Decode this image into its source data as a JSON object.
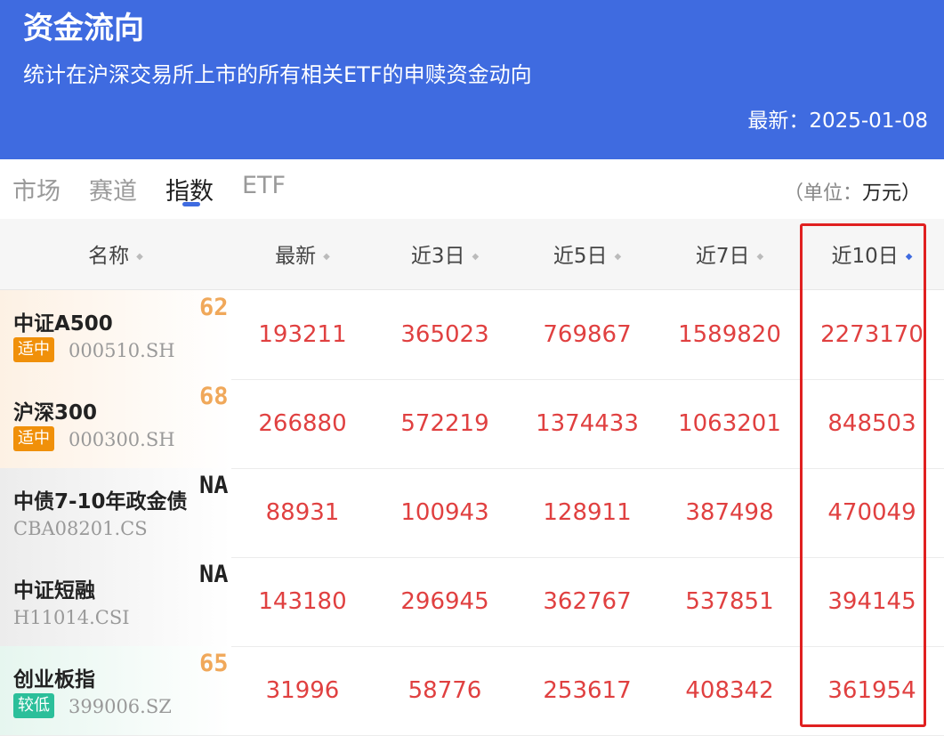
{
  "header": {
    "title": "资金流向",
    "subtitle": "统计在沪深交易所上市的所有相关ETF的申赎资金动向",
    "updated": "最新：2025-01-08"
  },
  "tabs": [
    {
      "label": "市场",
      "active": false
    },
    {
      "label": "赛道",
      "active": false
    },
    {
      "label": "指数",
      "active": true
    },
    {
      "label": "ETF",
      "active": false
    }
  ],
  "unit": {
    "prefix": "（单位：",
    "value": "万元）"
  },
  "columns": [
    "名称",
    "最新",
    "近3日",
    "近5日",
    "近7日",
    "近10日"
  ],
  "sorted_column": "近10日",
  "rows": [
    {
      "name": "中证A500",
      "badge": "适中",
      "badge_color": "#f0900a",
      "code": "000510.SH",
      "score": "62",
      "score_color": "#f0a85a",
      "bg": "#fdf1e4",
      "values": [
        "193211",
        "365023",
        "769867",
        "1589820",
        "2273170"
      ]
    },
    {
      "name": "沪深300",
      "badge": "适中",
      "badge_color": "#f0900a",
      "code": "000300.SH",
      "score": "68",
      "score_color": "#f0a85a",
      "bg": "#fdf1e4",
      "values": [
        "266880",
        "572219",
        "1374433",
        "1063201",
        "848503"
      ]
    },
    {
      "name": "中债7-10年政金债",
      "badge": "",
      "badge_color": "",
      "code": "CBA08201.CS",
      "score": "NA",
      "score_color": "#222222",
      "bg": "#ececec",
      "values": [
        "88931",
        "100943",
        "128911",
        "387498",
        "470049"
      ]
    },
    {
      "name": "中证短融",
      "badge": "",
      "badge_color": "",
      "code": "H11014.CSI",
      "score": "NA",
      "score_color": "#222222",
      "bg": "#ececec",
      "values": [
        "143180",
        "296945",
        "362767",
        "537851",
        "394145"
      ]
    },
    {
      "name": "创业板指",
      "badge": "较低",
      "badge_color": "#2bbf9a",
      "code": "399006.SZ",
      "score": "65",
      "score_color": "#f0a85a",
      "bg": "#e6f6ef",
      "values": [
        "31996",
        "58776",
        "253617",
        "408342",
        "361954"
      ]
    }
  ],
  "colors": {
    "header_bg": "#3f6be0",
    "value_red": "#e04040",
    "highlight_border": "#e02020"
  }
}
